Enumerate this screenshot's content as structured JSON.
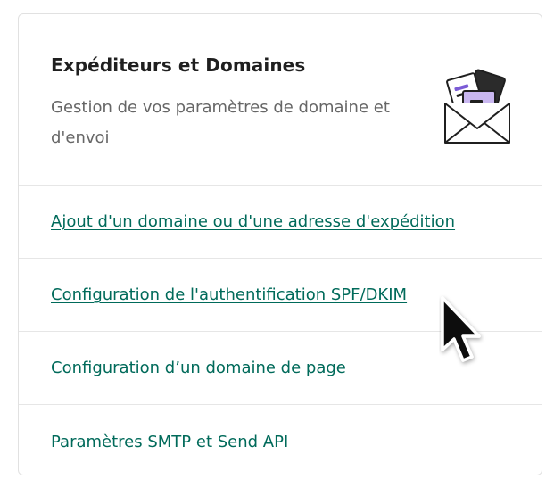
{
  "card": {
    "title": "Expéditeurs et Domaines",
    "description": "Gestion de vos paramètres de domaine et d'envoi",
    "illustration": "envelope-with-documents-icon",
    "links": [
      {
        "label": "Ajout d'un domaine ou d'une adresse d'expédition"
      },
      {
        "label": "Configuration de l'authentification SPF/DKIM"
      },
      {
        "label": "Configuration d’un domaine de page"
      },
      {
        "label": "Paramètres SMTP et Send API"
      }
    ]
  },
  "colors": {
    "link": "#006a5a",
    "title": "#1f1f1f",
    "description": "#666666",
    "border": "#e1e1e1",
    "illustration_accent": "#c9b7f0"
  },
  "cursor": "mouse-pointer-icon"
}
